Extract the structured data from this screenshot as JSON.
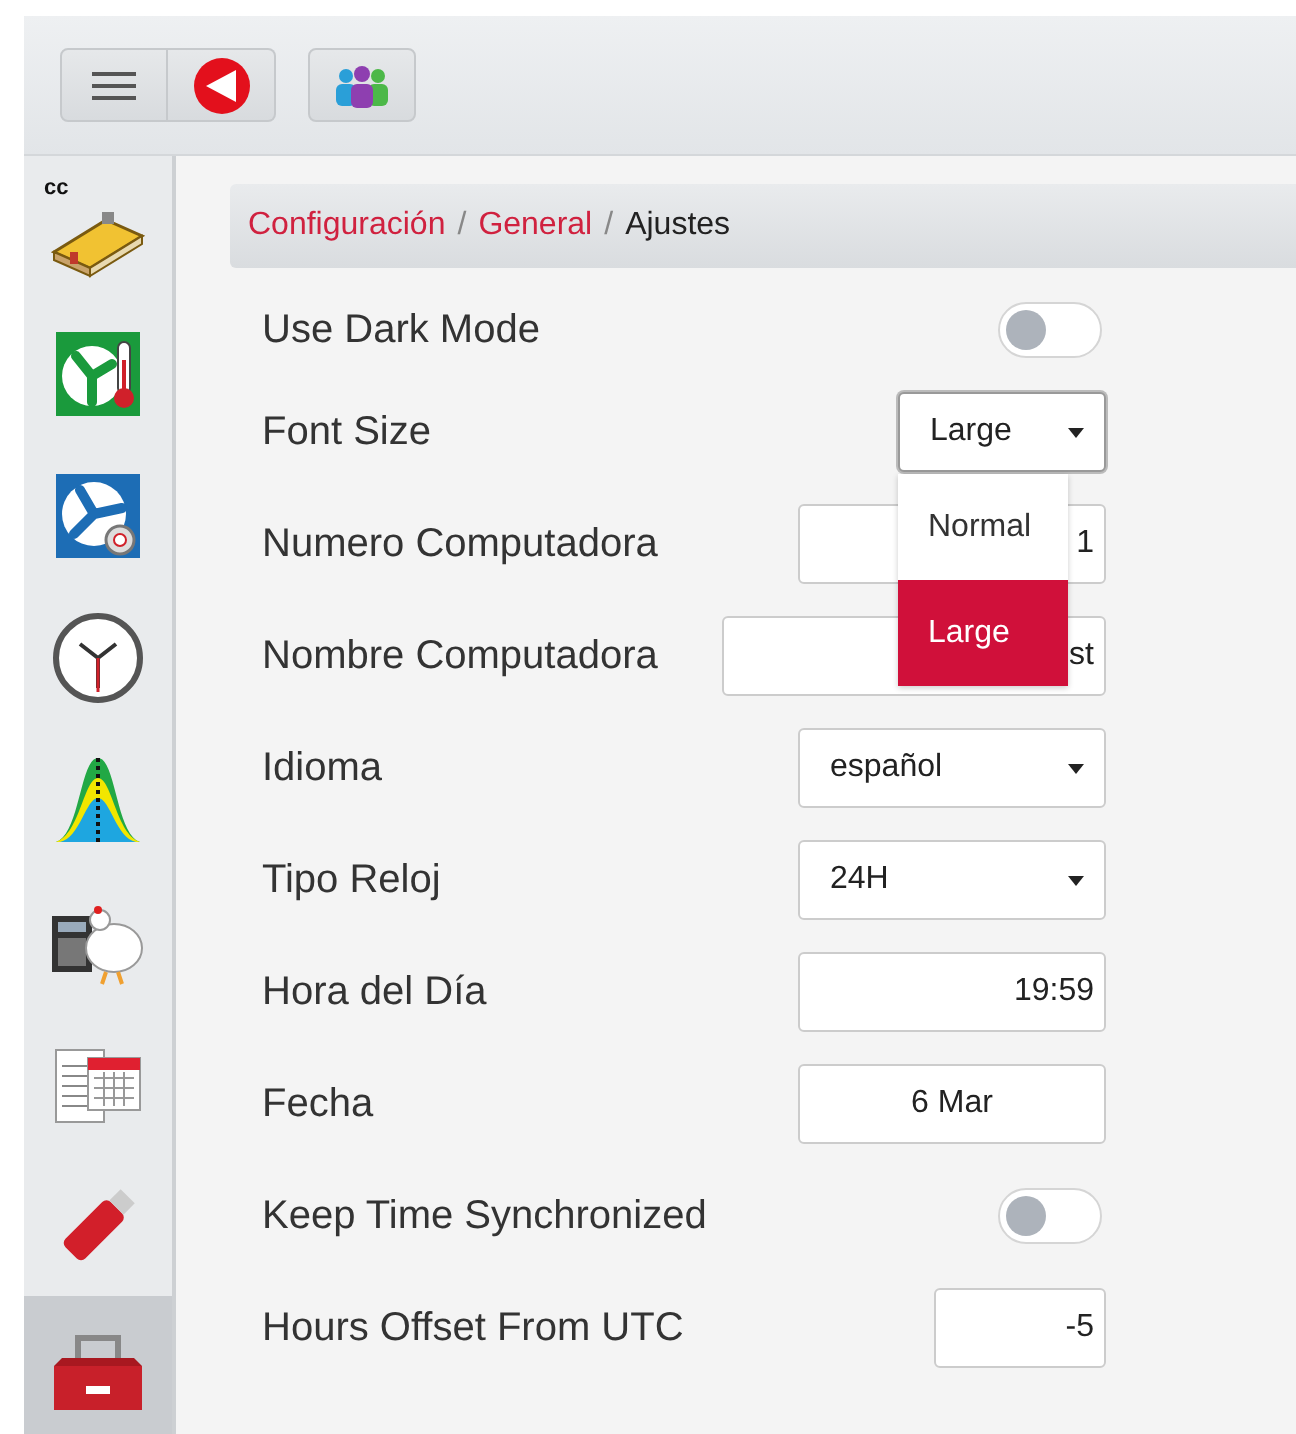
{
  "sidebar": {
    "items": [
      {
        "label": "cc",
        "selected": false
      },
      {
        "selected": false
      },
      {
        "selected": false
      },
      {
        "selected": false
      },
      {
        "selected": false
      },
      {
        "selected": false
      },
      {
        "selected": false
      },
      {
        "selected": false
      },
      {
        "selected": true
      }
    ]
  },
  "breadcrumb": [
    {
      "kind": "link",
      "text": "Configuración"
    },
    {
      "kind": "separator",
      "text": "/"
    },
    {
      "kind": "link",
      "text": "General"
    },
    {
      "kind": "separator",
      "text": "/"
    },
    {
      "kind": "current",
      "text": "Ajustes"
    }
  ],
  "settings": [
    {
      "kind": "toggle",
      "label": "Use Dark Mode",
      "on": false
    },
    {
      "kind": "select",
      "label": "Font Size",
      "value": "Large",
      "expanded": true,
      "options": [
        {
          "text": "Normal",
          "selected": false
        },
        {
          "text": "Large",
          "selected": true
        }
      ]
    },
    {
      "kind": "input",
      "label": "Numero Computadora",
      "value": "1"
    },
    {
      "kind": "input",
      "label": "Nombre Computadora",
      "value": "st"
    },
    {
      "kind": "select",
      "label": "Idioma",
      "value": "español"
    },
    {
      "kind": "select",
      "label": "Tipo Reloj",
      "value": "24H"
    },
    {
      "kind": "input",
      "label": "Hora del Día",
      "value": "19:59"
    },
    {
      "kind": "date",
      "label": "Fecha",
      "value": "6 Mar"
    },
    {
      "kind": "toggle",
      "label": "Keep Time Synchronized",
      "on": false
    },
    {
      "kind": "input",
      "label": "Hours Offset From UTC",
      "value": "-5"
    }
  ]
}
